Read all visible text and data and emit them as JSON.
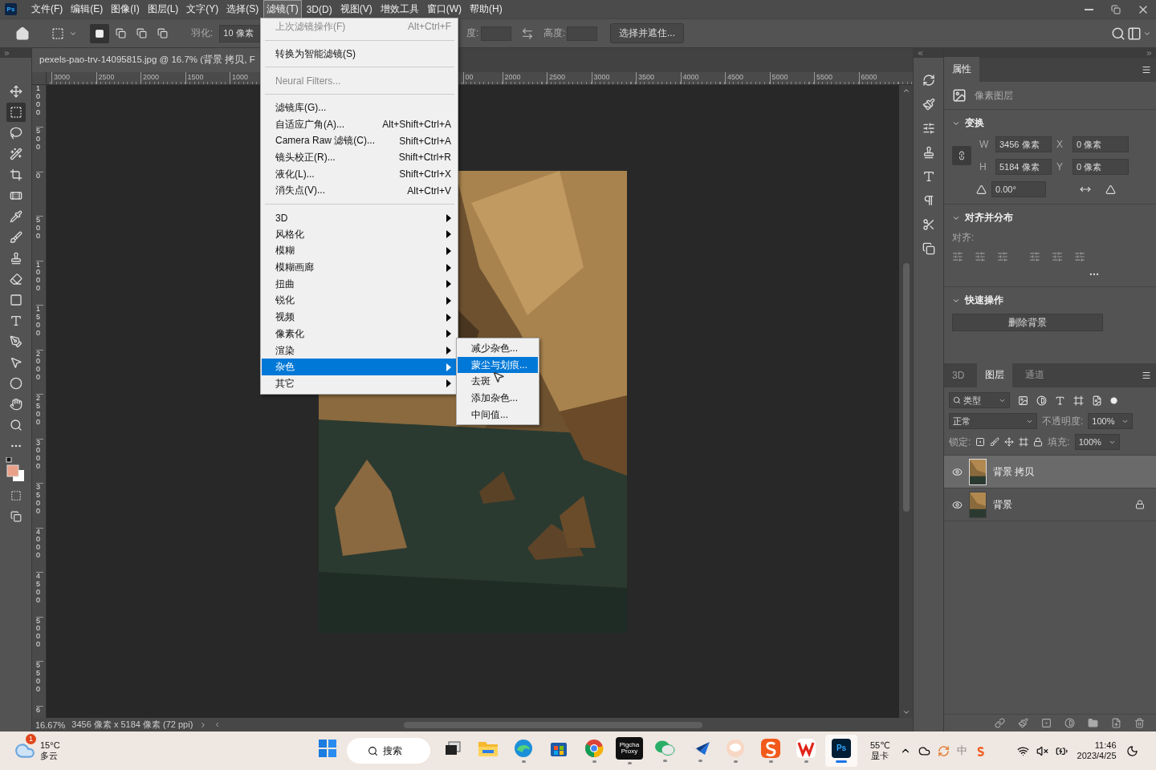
{
  "app_logo": "Ps",
  "menu_bar": [
    {
      "label": "文件(F)",
      "selected": false
    },
    {
      "label": "编辑(E)",
      "selected": false
    },
    {
      "label": "图像(I)",
      "selected": false
    },
    {
      "label": "图层(L)",
      "selected": false
    },
    {
      "label": "文字(Y)",
      "selected": false
    },
    {
      "label": "选择(S)",
      "selected": false
    },
    {
      "label": "滤镜(T)",
      "selected": true
    },
    {
      "label": "3D(D)",
      "selected": false
    },
    {
      "label": "视图(V)",
      "selected": false
    },
    {
      "label": "增效工具",
      "selected": false
    },
    {
      "label": "窗口(W)",
      "selected": false
    },
    {
      "label": "帮助(H)",
      "selected": false
    }
  ],
  "options_bar": {
    "feather_label": "羽化:",
    "feather_value": "10 像素",
    "width_label": "度:",
    "height_label": "高度:",
    "refine_button": "选择并遮住..."
  },
  "document_tab": {
    "title": "pexels-pao-trv-14095815.jpg @ 16.7% (背景 拷贝, F"
  },
  "horizontal_ruler": {
    "left_labels": [
      "3000",
      "2500",
      "2000",
      "1500",
      "1000"
    ],
    "right_labels": [
      "00",
      "2000",
      "2500",
      "3000",
      "3500",
      "4000",
      "4500",
      "5000",
      "5500",
      "6000"
    ]
  },
  "vertical_ruler": {
    "labels": [
      "1000",
      "500",
      "0",
      "500",
      "1000",
      "1500",
      "2000",
      "2500",
      "3000",
      "3500",
      "4000",
      "4500",
      "5000",
      "5500",
      "6"
    ]
  },
  "filter_menu": {
    "items": [
      {
        "kind": "item",
        "label": "上次滤镜操作(F)",
        "shortcut": "Alt+Ctrl+F",
        "disabled": true,
        "selected": false
      },
      {
        "kind": "separator"
      },
      {
        "kind": "item",
        "label": "转换为智能滤镜(S)",
        "disabled": false,
        "selected": false
      },
      {
        "kind": "separator"
      },
      {
        "kind": "item",
        "label": "Neural Filters...",
        "disabled": true,
        "selected": false
      },
      {
        "kind": "separator"
      },
      {
        "kind": "item",
        "label": "滤镜库(G)...",
        "disabled": false,
        "selected": false
      },
      {
        "kind": "item",
        "label": "自适应广角(A)...",
        "shortcut": "Alt+Shift+Ctrl+A",
        "disabled": false,
        "selected": false
      },
      {
        "kind": "item",
        "label": "Camera Raw 滤镜(C)...",
        "shortcut": "Shift+Ctrl+A",
        "disabled": false,
        "selected": false
      },
      {
        "kind": "item",
        "label": "镜头校正(R)...",
        "shortcut": "Shift+Ctrl+R",
        "disabled": false,
        "selected": false
      },
      {
        "kind": "item",
        "label": "液化(L)...",
        "shortcut": "Shift+Ctrl+X",
        "disabled": false,
        "selected": false
      },
      {
        "kind": "item",
        "label": "消失点(V)...",
        "shortcut": "Alt+Ctrl+V",
        "disabled": false,
        "selected": false
      },
      {
        "kind": "separator"
      },
      {
        "kind": "submenu",
        "label": "3D",
        "disabled": false,
        "selected": false
      },
      {
        "kind": "submenu",
        "label": "风格化",
        "disabled": false,
        "selected": false
      },
      {
        "kind": "submenu",
        "label": "模糊",
        "disabled": false,
        "selected": false
      },
      {
        "kind": "submenu",
        "label": "模糊画廊",
        "disabled": false,
        "selected": false
      },
      {
        "kind": "submenu",
        "label": "扭曲",
        "disabled": false,
        "selected": false
      },
      {
        "kind": "submenu",
        "label": "锐化",
        "disabled": false,
        "selected": false
      },
      {
        "kind": "submenu",
        "label": "视频",
        "disabled": false,
        "selected": false
      },
      {
        "kind": "submenu",
        "label": "像素化",
        "disabled": false,
        "selected": false
      },
      {
        "kind": "submenu",
        "label": "渲染",
        "disabled": false,
        "selected": false
      },
      {
        "kind": "submenu",
        "label": "杂色",
        "disabled": false,
        "selected": true
      },
      {
        "kind": "submenu",
        "label": "其它",
        "disabled": false,
        "selected": false
      }
    ]
  },
  "noise_submenu": {
    "items": [
      {
        "label": "减少杂色...",
        "selected": false
      },
      {
        "label": "蒙尘与划痕...",
        "selected": true
      },
      {
        "label": "去斑",
        "selected": false
      },
      {
        "label": "添加杂色...",
        "selected": false
      },
      {
        "label": "中间值...",
        "selected": false
      }
    ]
  },
  "properties": {
    "tab": "属性",
    "layer_type": "像素图层",
    "transform": {
      "title": "变换",
      "expanded": true,
      "fields": [
        {
          "label": "W",
          "value": "3456 像素"
        },
        {
          "label": "X",
          "value": "0 像素"
        },
        {
          "label": "H",
          "value": "5184 像素"
        },
        {
          "label": "Y",
          "value": "0 像素"
        }
      ],
      "angle": "0.00°"
    },
    "align": {
      "title": "对齐并分布",
      "expanded": true,
      "label": "对齐:"
    },
    "quick_actions": {
      "title": "快速操作",
      "expanded": true,
      "button": "删除背景"
    }
  },
  "layers_panel": {
    "tabs": [
      {
        "label": "3D",
        "selected": false
      },
      {
        "label": "图层",
        "selected": true
      },
      {
        "label": "通道",
        "selected": false
      }
    ],
    "filter": "类型",
    "blend_mode": "正常",
    "opacity_label": "不透明度:",
    "opacity": "100%",
    "lock_label": "锁定:",
    "fill_label": "填充:",
    "fill": "100%",
    "layers": [
      {
        "name": "背景 拷贝",
        "visible": true,
        "locked": false,
        "selected": true
      },
      {
        "name": "背景",
        "visible": true,
        "locked": true,
        "selected": false
      }
    ]
  },
  "status_bar": {
    "zoom": "16.67%",
    "info": "3456 像素 x 5184 像素 (72 ppi)"
  },
  "taskbar": {
    "weather": {
      "badge": "1",
      "temp": "15°C",
      "condition": "多云"
    },
    "search": "搜索",
    "apps": [
      {
        "kind": "start",
        "running": false,
        "selected": false
      },
      {
        "kind": "taskview",
        "running": false,
        "selected": false
      },
      {
        "kind": "explorer",
        "running": false,
        "selected": false
      },
      {
        "kind": "edge",
        "running": true,
        "selected": false
      },
      {
        "kind": "store",
        "running": false,
        "selected": false
      },
      {
        "kind": "chrome",
        "running": true,
        "selected": false
      },
      {
        "kind": "proxy",
        "label": "Pigcha Proxy",
        "running": true,
        "selected": false
      },
      {
        "kind": "wechat",
        "running": true,
        "selected": false
      },
      {
        "kind": "bird",
        "running": true,
        "selected": false
      },
      {
        "kind": "bubble",
        "running": true,
        "selected": false
      },
      {
        "kind": "sogou",
        "running": true,
        "selected": false
      },
      {
        "kind": "wps",
        "running": true,
        "selected": false
      },
      {
        "kind": "photoshop",
        "label": "Ps",
        "running": true,
        "selected": true
      }
    ],
    "gpu": {
      "temp": "55℃",
      "label": "显卡"
    },
    "ime": "中",
    "time": "11:46",
    "date": "2023/4/25"
  }
}
